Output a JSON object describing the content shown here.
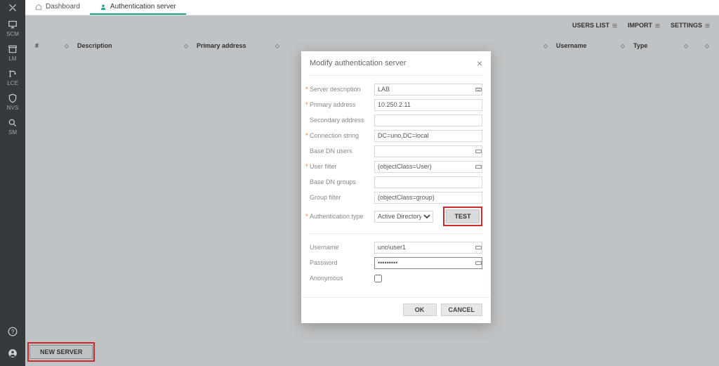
{
  "sidebar": {
    "items": [
      {
        "label": "SCM"
      },
      {
        "label": "LM"
      },
      {
        "label": "LCE"
      },
      {
        "label": "NVS"
      },
      {
        "label": "SM"
      }
    ]
  },
  "tabs": {
    "dashboard": "Dashboard",
    "auth": "Authentication server"
  },
  "toolbar": {
    "users": "USERS LIST",
    "import": "IMPORT",
    "settings": "SETTINGS"
  },
  "columns": {
    "num": "#",
    "desc": "Description",
    "prim": "Primary address",
    "user": "Username",
    "type": "Type"
  },
  "buttons": {
    "newserver": "NEW SERVER"
  },
  "dialog": {
    "title": "Modify authentication server",
    "labels": {
      "serverdesc": "Server description",
      "primary": "Primary address",
      "secondary": "Secondary address",
      "connstr": "Connection string",
      "dnusers": "Base DN users",
      "userfilter": "User filter",
      "dngroups": "Base DN groups",
      "groupfilter": "Group filter",
      "authtype": "Authentication type",
      "username": "Username",
      "password": "Password",
      "anonymous": "Anonymous"
    },
    "values": {
      "serverdesc": "LAB",
      "primary": "10.250.2.11",
      "secondary": "",
      "connstr": "DC=uno,DC=local",
      "dnusers": "",
      "userfilter": "(objectClass=User)",
      "dngroups": "",
      "groupfilter": "(objectClass=group)",
      "authtype": "Active Directory",
      "username": "uno\\user1",
      "password": "•••••••••"
    },
    "buttons": {
      "test": "TEST",
      "ok": "OK",
      "cancel": "CANCEL"
    }
  }
}
